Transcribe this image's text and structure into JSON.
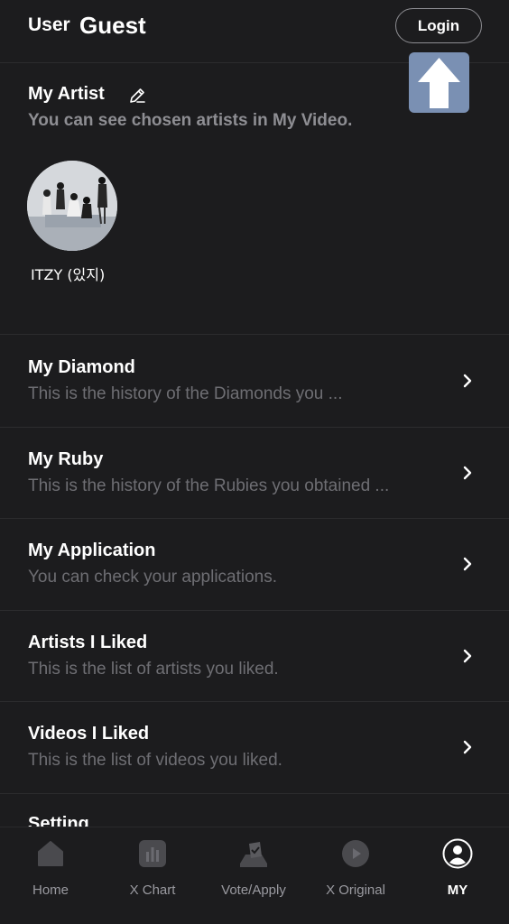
{
  "header": {
    "user_label": "User",
    "user_name": "Guest",
    "login_label": "Login"
  },
  "my_artist": {
    "title": "My Artist",
    "subtitle": "You can see chosen artists in My Video.",
    "artists": [
      {
        "name": "ITZY (있지)"
      }
    ]
  },
  "menu": [
    {
      "title": "My Diamond",
      "subtitle": "This is the history of the Diamonds you ..."
    },
    {
      "title": "My Ruby",
      "subtitle": "This is the history of the Rubies you obtained ..."
    },
    {
      "title": "My Application",
      "subtitle": "You can check your applications."
    },
    {
      "title": "Artists I Liked",
      "subtitle": "This is the list of artists you liked."
    },
    {
      "title": "Videos I Liked",
      "subtitle": "This is the list of videos you liked."
    }
  ],
  "setting": {
    "title": "Setting"
  },
  "tabbar": {
    "items": [
      {
        "label": "Home",
        "icon": "home-icon"
      },
      {
        "label": "X Chart",
        "icon": "chart-icon"
      },
      {
        "label": "Vote/Apply",
        "icon": "vote-icon"
      },
      {
        "label": "X Original",
        "icon": "play-icon"
      },
      {
        "label": "MY",
        "icon": "profile-icon",
        "active": true
      }
    ]
  },
  "colors": {
    "background": "#1c1c1e",
    "secondary_text": "#6e6e73",
    "arrow_overlay": "#7a90b3"
  }
}
